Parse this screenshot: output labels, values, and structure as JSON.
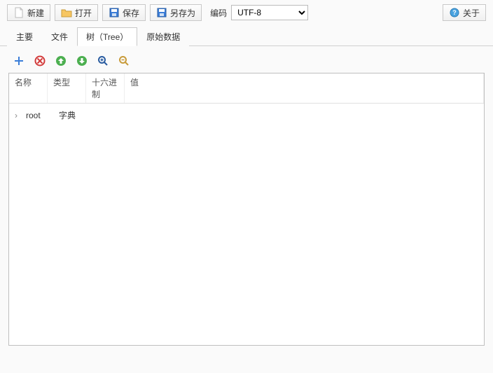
{
  "toolbar": {
    "new_label": "新建",
    "open_label": "打开",
    "save_label": "保存",
    "saveas_label": "另存为",
    "encoding_label": "编码",
    "encoding_value": "UTF-8",
    "about_label": "关于"
  },
  "tabs": {
    "main": "主要",
    "file": "文件",
    "tree": "树（Tree）",
    "raw": "原始数据",
    "active": "tree"
  },
  "tree": {
    "columns": {
      "name": "名称",
      "type": "类型",
      "hex": "十六进制",
      "value": "值"
    },
    "rows": [
      {
        "expand": "›",
        "name": "root",
        "type": "字典",
        "hex": "",
        "value": ""
      }
    ]
  },
  "iconbar": {
    "add": "add-icon",
    "remove": "remove-icon",
    "up": "up-icon",
    "down": "down-icon",
    "zoomin": "zoom-in-icon",
    "zoomout": "zoom-out-icon"
  }
}
